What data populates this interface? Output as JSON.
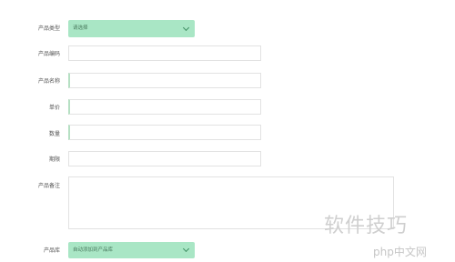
{
  "form": {
    "product_type": {
      "label": "产品类型",
      "value": "请选择"
    },
    "product_code": {
      "label": "产品编码",
      "value": ""
    },
    "product_name": {
      "label": "产品名称",
      "value": ""
    },
    "unit_price": {
      "label": "单价",
      "value": ""
    },
    "quantity": {
      "label": "数量",
      "value": ""
    },
    "deadline": {
      "label": "期限",
      "value": ""
    },
    "remark": {
      "label": "产品备注",
      "value": ""
    },
    "product_store": {
      "label": "产品库",
      "value": "自动添加到产品库"
    }
  },
  "watermark": {
    "tips": "软件技巧",
    "logo": "php中文网"
  }
}
